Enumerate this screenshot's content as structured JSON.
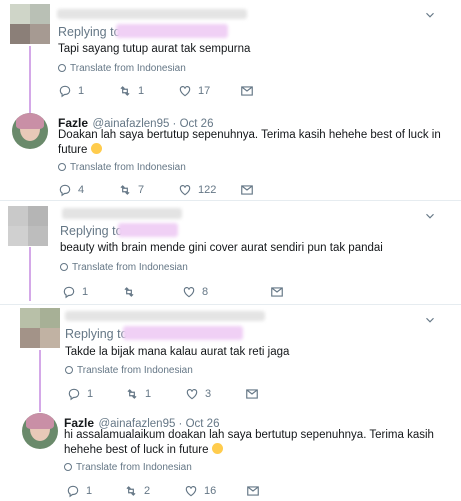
{
  "tweets": [
    {
      "replying_to": "Replying to",
      "text": "Tapi sayang tutup aurat tak sempurna",
      "translate": "Translate from Indonesian",
      "reply_count": "1",
      "retweet_count": "1",
      "like_count": "17"
    },
    {
      "name": "Fazle",
      "handle": "@ainafazlen95 · Oct 26",
      "text": "Doakan lah saya bertutup sepenuhnya. Terima kasih hehehe best of luck in",
      "text2": "future",
      "translate": "Translate from Indonesian",
      "reply_count": "4",
      "retweet_count": "7",
      "like_count": "122"
    },
    {
      "replying_to": "Replying to",
      "text": "beauty with brain mende gini cover aurat sendiri pun tak pandai",
      "translate": "Translate from Indonesian",
      "reply_count": "1",
      "retweet_count": "",
      "like_count": "8"
    },
    {
      "replying_to": "Replying to",
      "text": "Takde la bijak mana kalau aurat tak reti jaga",
      "translate": "Translate from Indonesian",
      "reply_count": "1",
      "retweet_count": "1",
      "like_count": "3"
    },
    {
      "name": "Fazle",
      "handle": "@ainafazlen95 · Oct 26",
      "text": "hi assalamualaikum doakan lah saya bertutup sepenuhnya. Terima kasih",
      "text2": "hehehe best of luck in future",
      "translate": "Translate from Indonesian",
      "reply_count": "1",
      "retweet_count": "2",
      "like_count": "16"
    }
  ],
  "colors": {
    "thread": "#d4a8e8",
    "muted": "#657786",
    "redacted": "#f0d0f5"
  },
  "icons": [
    "reply-icon",
    "retweet-icon",
    "like-icon",
    "dm-icon",
    "chevron-down-icon",
    "globe-icon"
  ]
}
